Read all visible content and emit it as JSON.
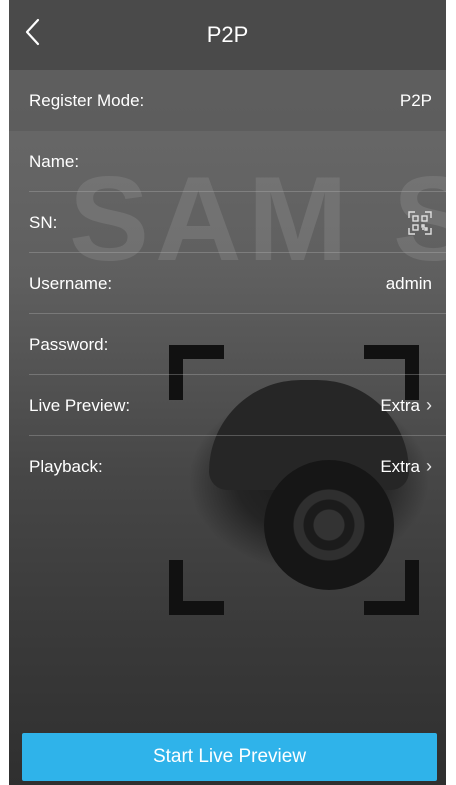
{
  "header": {
    "title": "P2P"
  },
  "form": {
    "rows": [
      {
        "label": "Register Mode:",
        "value": "P2P"
      },
      {
        "label": "Name:",
        "value": ""
      },
      {
        "label": "SN:",
        "value": ""
      },
      {
        "label": "Username:",
        "value": "admin"
      },
      {
        "label": "Password:",
        "value": ""
      },
      {
        "label": "Live Preview:",
        "value": "Extra"
      },
      {
        "label": "Playback:",
        "value": "Extra"
      }
    ]
  },
  "footer": {
    "start_button_label": "Start Live Preview"
  },
  "colors": {
    "accent": "#2fb3ea",
    "header_bg": "#4a4a4a"
  },
  "icons": [
    "back-arrow-icon",
    "qr-scan-icon",
    "chevron-right-icon"
  ]
}
